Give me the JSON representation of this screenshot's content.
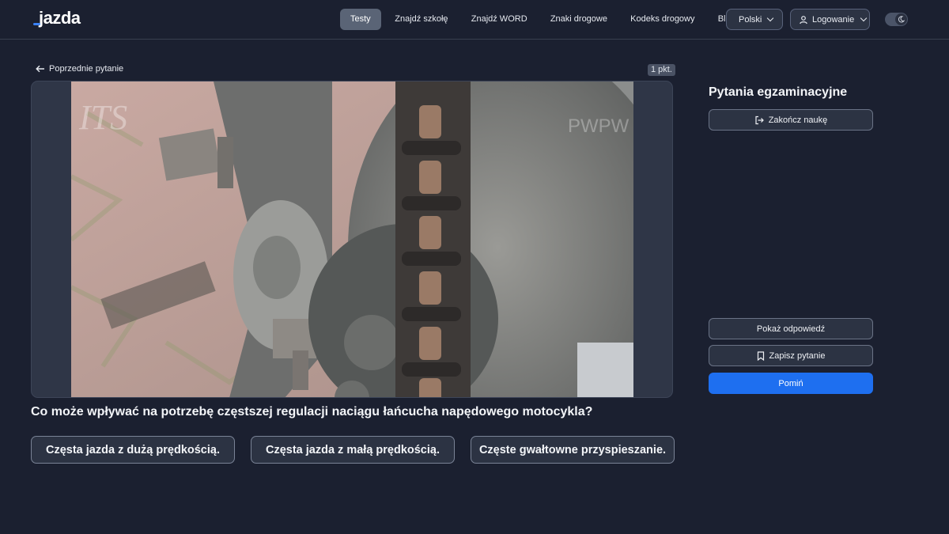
{
  "header": {
    "logo": "jazda",
    "nav": [
      {
        "label": "Testy",
        "active": true
      },
      {
        "label": "Znajdź szkołę"
      },
      {
        "label": "Znajdź WORD"
      },
      {
        "label": "Znaki drogowe"
      },
      {
        "label": "Kodeks drogowy"
      },
      {
        "label": "Blog"
      }
    ],
    "language": "Polski",
    "login": "Logowanie"
  },
  "question": {
    "prev_label": "Poprzednie pytanie",
    "points": "1 pkt.",
    "text": "Co może wpływać na potrzebę częstszej regulacji naciągu łańcucha napędowego motocykla?",
    "watermarks": [
      "ITS",
      "PWPW"
    ],
    "answers": [
      "Częsta jazda z dużą prędkością.",
      "Częsta jazda z małą prędkością.",
      "Częste gwałtowne przyspieszanie."
    ]
  },
  "sidebar": {
    "title": "Pytania egzaminacyjne",
    "end_label": "Zakończ naukę",
    "show_answer_label": "Pokaż odpowiedź",
    "save_label": "Zapisz pytanie",
    "skip_label": "Pomiń"
  },
  "colors": {
    "background": "#1b2030",
    "accent": "#1e6ff0",
    "brand": "#3b82f6"
  }
}
